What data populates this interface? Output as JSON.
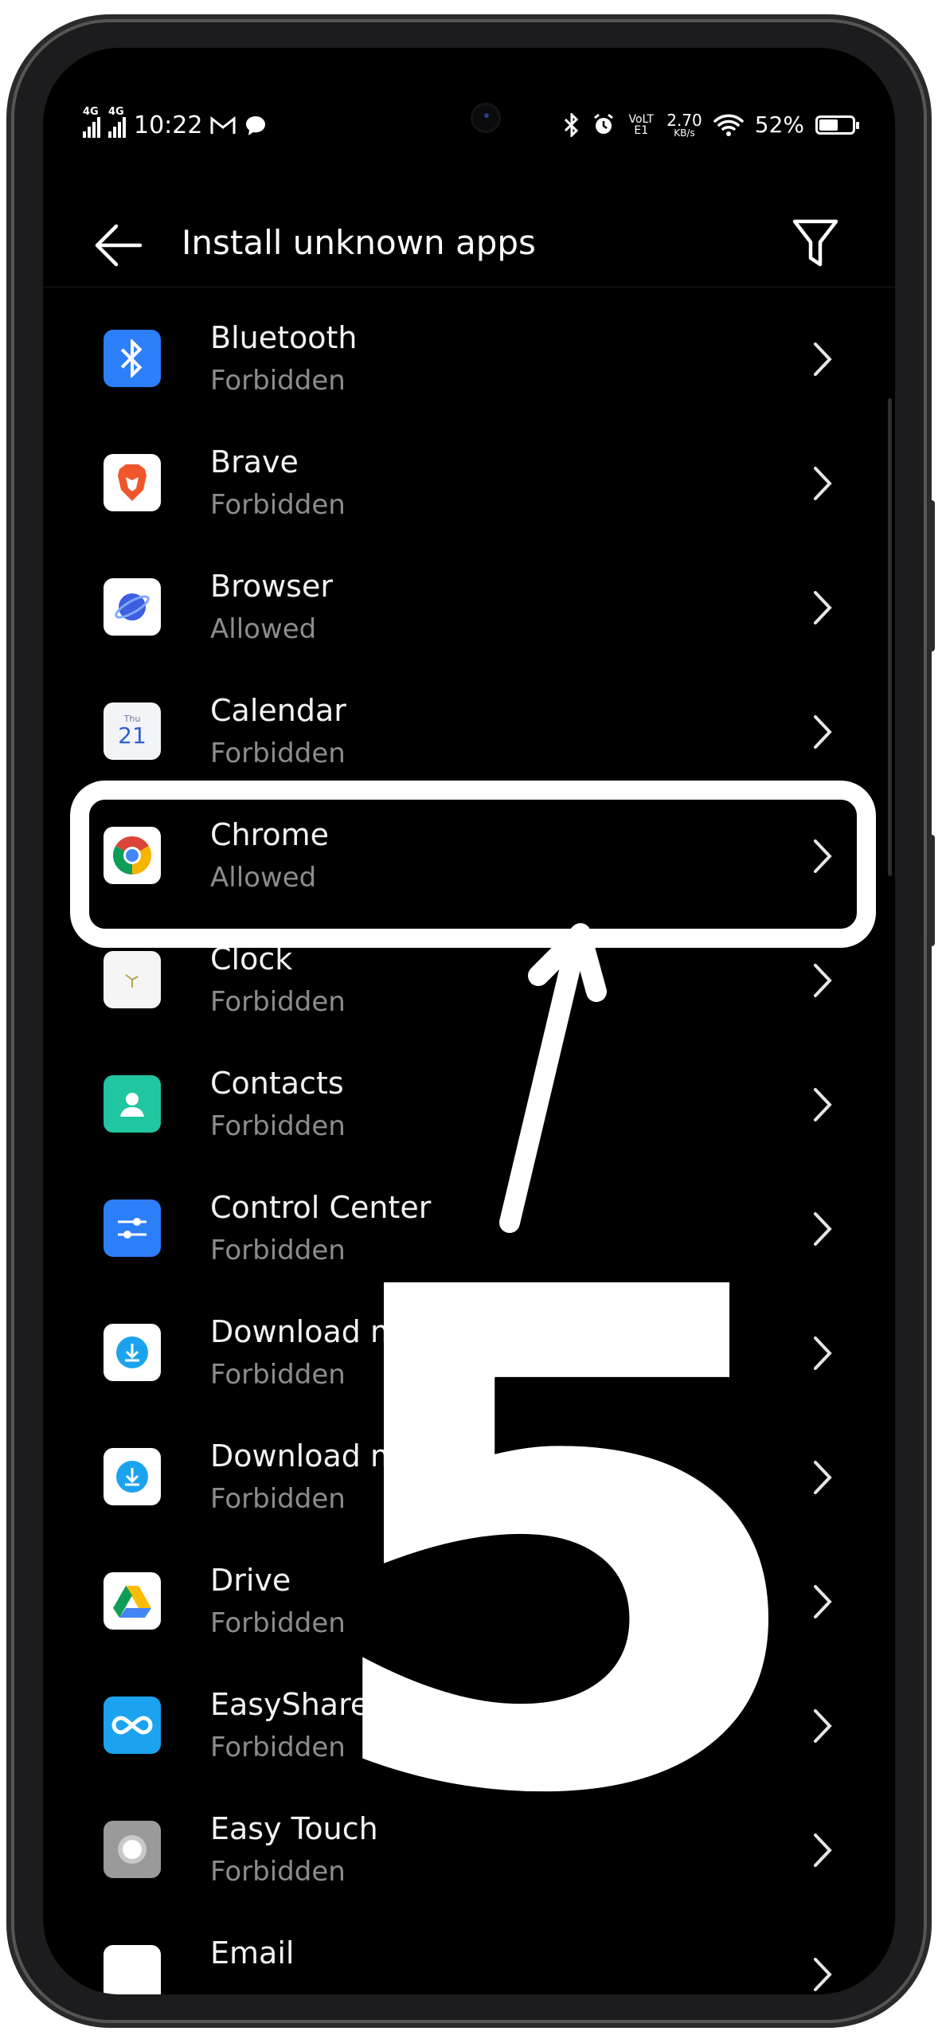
{
  "status_bar": {
    "network1": "4G",
    "network2": "4G",
    "time": "10:22",
    "volte": "VoLTE1",
    "speed_value": "2.70",
    "speed_unit": "KB/s",
    "battery": "52%",
    "battery_level": 0.52
  },
  "header": {
    "title": "Install unknown apps"
  },
  "apps": [
    {
      "name": "Bluetooth",
      "status": "Forbidden",
      "icon": "bluetooth-icon",
      "color": "#2d7ff9"
    },
    {
      "name": "Brave",
      "status": "Forbidden",
      "icon": "brave-icon",
      "color": "#ffffff"
    },
    {
      "name": "Browser",
      "status": "Allowed",
      "icon": "browser-icon",
      "color": "#ffffff"
    },
    {
      "name": "Calendar",
      "status": "Forbidden",
      "icon": "calendar-icon",
      "color": "#f2f4f8",
      "icon_text_top": "Thu",
      "icon_text": "21"
    },
    {
      "name": "Chrome",
      "status": "Allowed",
      "icon": "chrome-icon",
      "color": "#ffffff"
    },
    {
      "name": "Clock",
      "status": "Forbidden",
      "icon": "clock-icon",
      "color": "#f5f5f5"
    },
    {
      "name": "Contacts",
      "status": "Forbidden",
      "icon": "contacts-icon",
      "color": "#1fc6a0"
    },
    {
      "name": "Control Center",
      "status": "Forbidden",
      "icon": "control-center-icon",
      "color": "#2d7ff9"
    },
    {
      "name": "Download ma",
      "status": "Forbidden",
      "icon": "download-icon",
      "color": "#ffffff"
    },
    {
      "name": "Download m",
      "status": "Forbidden",
      "icon": "download-icon",
      "color": "#ffffff"
    },
    {
      "name": "Drive",
      "status": "Forbidden",
      "icon": "drive-icon",
      "color": "#ffffff"
    },
    {
      "name": "EasyShare",
      "status": "Forbidden",
      "icon": "easyshare-icon",
      "color": "#1ba3f0"
    },
    {
      "name": "Easy Touch",
      "status": "Forbidden",
      "icon": "easy-touch-icon",
      "color": "#9a9a9a"
    },
    {
      "name": "Email",
      "status": "",
      "icon": "email-icon",
      "color": "#ffffff"
    }
  ],
  "overlay": {
    "step_number": "5",
    "highlight_color": "#ffffff"
  }
}
